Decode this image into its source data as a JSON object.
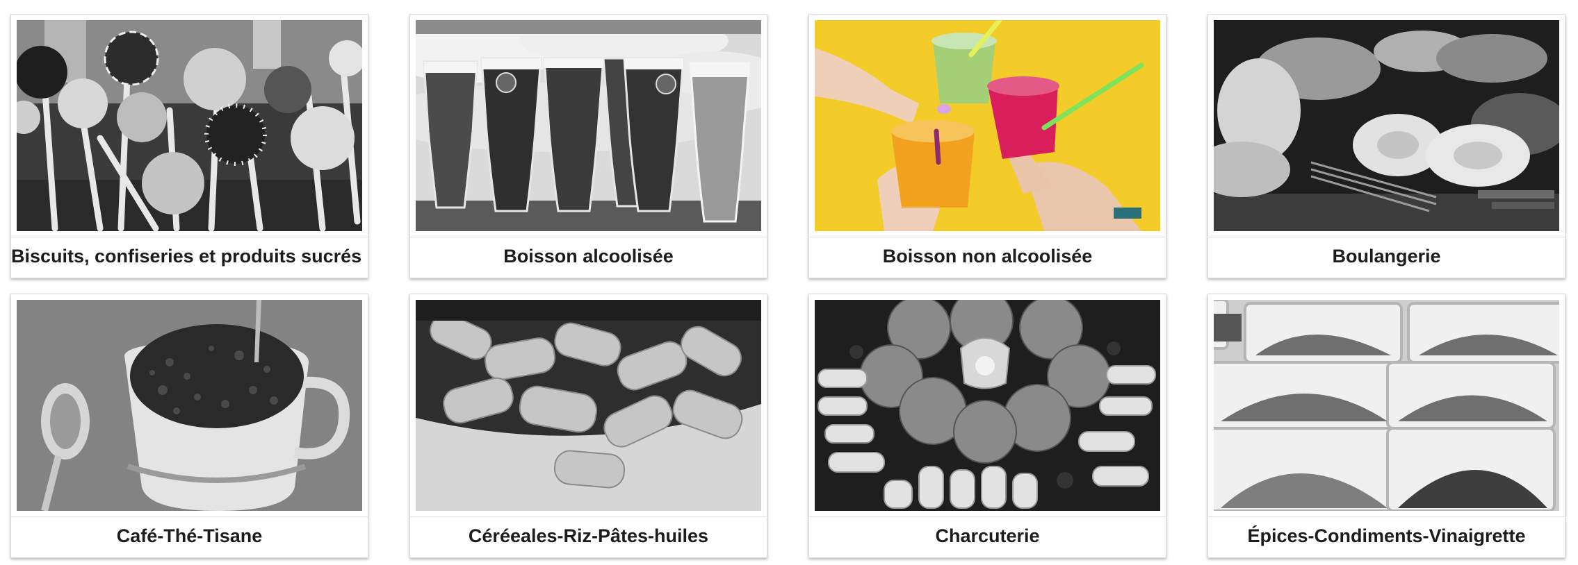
{
  "categories": [
    {
      "label": "Biscuits, confiseries et produits sucrés",
      "image": "cake-pops-photo",
      "tone": "grayscale"
    },
    {
      "label": "Boisson alcoolisée",
      "image": "beer-glasses-photo",
      "tone": "grayscale"
    },
    {
      "label": "Boisson non alcoolisée",
      "image": "smoothie-cups-photo",
      "tone": "color"
    },
    {
      "label": "Boulangerie",
      "image": "bread-rolls-photo",
      "tone": "grayscale"
    },
    {
      "label": "Café-Thé-Tisane",
      "image": "coffee-cup-photo",
      "tone": "grayscale"
    },
    {
      "label": "Céréeales-Riz-Pâtes-huiles",
      "image": "rigatoni-pasta-photo",
      "tone": "grayscale"
    },
    {
      "label": "Charcuterie",
      "image": "cold-cuts-platter-photo",
      "tone": "grayscale"
    },
    {
      "label": "Épices-Condiments-Vinaigrette",
      "image": "spice-trays-photo",
      "tone": "grayscale"
    }
  ],
  "colors": {
    "smoothie_background": "#f3cc2a",
    "orange_drink": "#f2a21e",
    "pink_drink": "#d81f5c",
    "green_drink": "#9fcf7a",
    "straw_green": "#7ee25a",
    "straw_yellow": "#e6f05a"
  }
}
